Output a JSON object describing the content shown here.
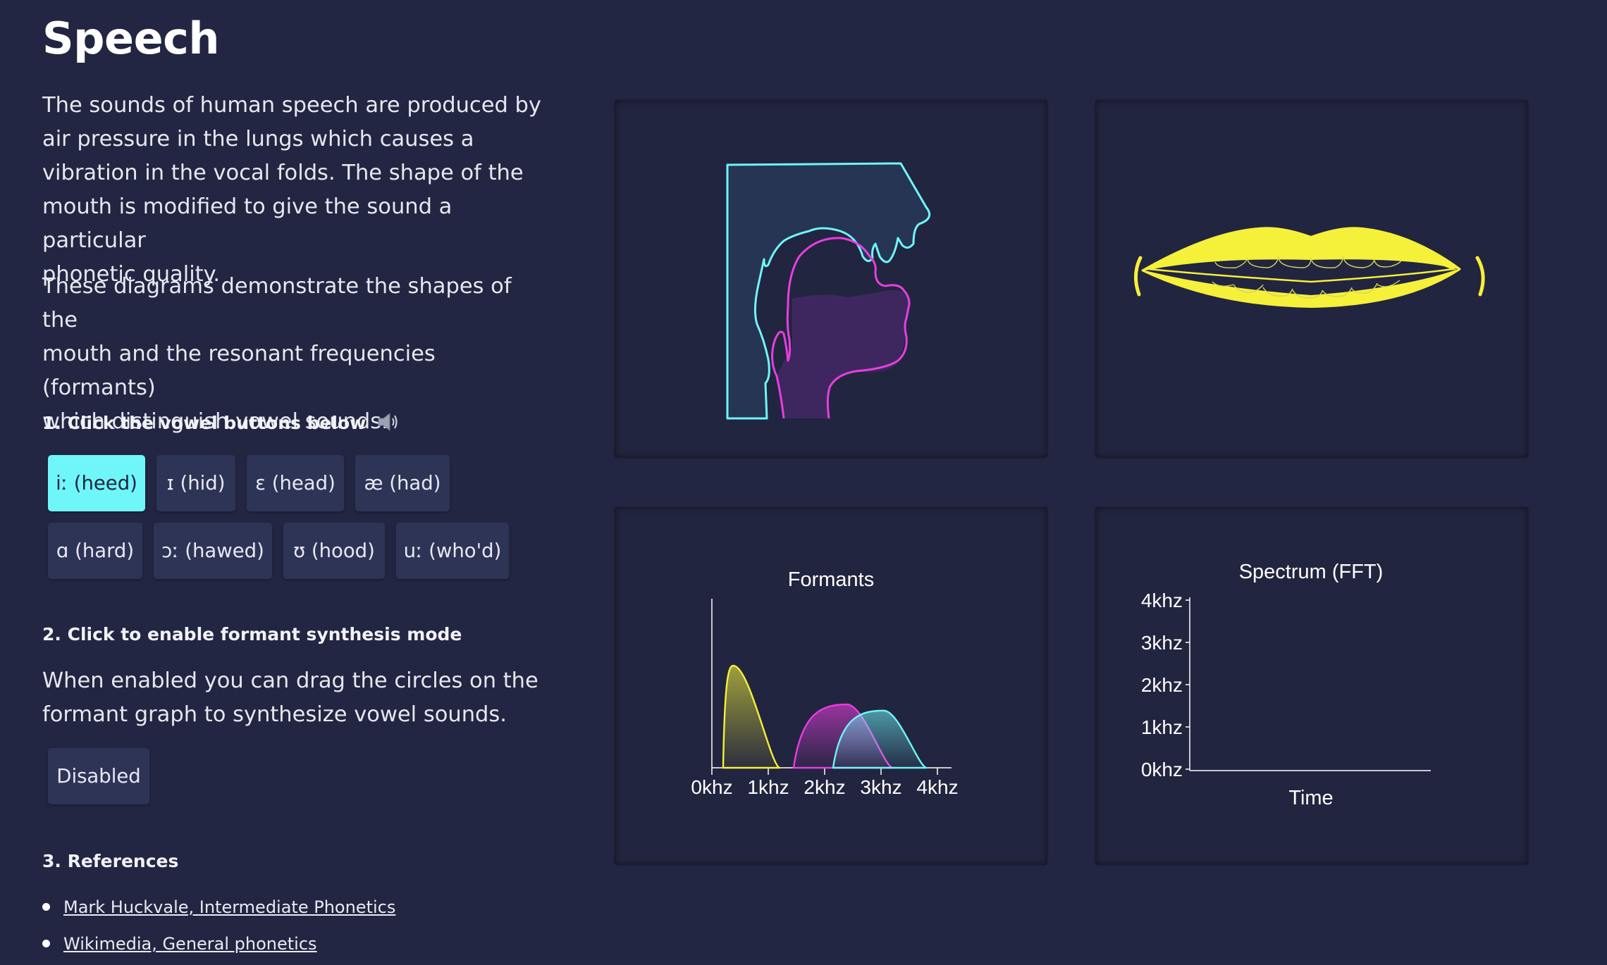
{
  "page": {
    "title": "Speech"
  },
  "intro": {
    "p1_lines": [
      "The sounds of human speech are produced by",
      "air pressure in the lungs which causes a",
      "vibration in the vocal folds. The shape of the",
      "mouth is modified to give the sound a particular",
      "phonetic quality."
    ],
    "p2_lines": [
      "These diagrams demonstrate the shapes of the",
      "mouth and the resonant frequencies (formants)",
      "which distinguish vowel sounds."
    ]
  },
  "step1": {
    "heading": "1. Click the vowel buttons below",
    "icon": "speaker-icon",
    "vowels": [
      {
        "label": "iː (heed)",
        "active": true
      },
      {
        "label": "ɪ (hid)",
        "active": false
      },
      {
        "label": "ɛ (head)",
        "active": false
      },
      {
        "label": "æ (had)",
        "active": false
      },
      {
        "label": "ɑ (hard)",
        "active": false
      },
      {
        "label": "ɔː (hawed)",
        "active": false
      },
      {
        "label": "ʊ (hood)",
        "active": false
      },
      {
        "label": "uː (who'd)",
        "active": false
      }
    ]
  },
  "step2": {
    "heading": "2. Click to enable formant synthesis mode",
    "desc_lines": [
      "When enabled you can drag the circles on the",
      "formant graph to synthesize vowel sounds."
    ],
    "toggle_label": "Disabled"
  },
  "step3": {
    "heading": "3. References",
    "links": [
      {
        "label": "Mark Huckvale, Intermediate Phonetics"
      },
      {
        "label": "Wikimedia, General phonetics"
      }
    ]
  },
  "colors": {
    "background": "#222642",
    "active_button": "#6ff6f8",
    "cyan": "#6ff6f8",
    "magenta": "#e83ee0",
    "yellow": "#f5f03a"
  },
  "chart_data": [
    {
      "type": "area",
      "title": "Formants",
      "xlabel": "",
      "ylabel": "",
      "x_ticks": [
        "0khz",
        "1khz",
        "2khz",
        "3khz",
        "4khz"
      ],
      "xlim": [
        0,
        4
      ],
      "series": [
        {
          "color": "#f5f03a",
          "start_khz": 0.2,
          "peak_khz": 0.38,
          "end_khz": 1.2,
          "peak_rel": 1.0
        },
        {
          "color": "#e83ee0",
          "start_khz": 1.45,
          "peak_khz": 2.4,
          "end_khz": 3.2,
          "peak_rel": 0.62
        },
        {
          "color": "#6ff6f8",
          "start_khz": 2.15,
          "peak_khz": 3.05,
          "end_khz": 3.8,
          "peak_rel": 0.56
        }
      ]
    },
    {
      "type": "heatmap",
      "title": "Spectrum (FFT)",
      "xlabel": "Time",
      "ylabel": "",
      "y_ticks": [
        "4khz",
        "3khz",
        "2khz",
        "1khz",
        "0khz"
      ],
      "ylim": [
        0,
        4
      ],
      "values": []
    }
  ]
}
